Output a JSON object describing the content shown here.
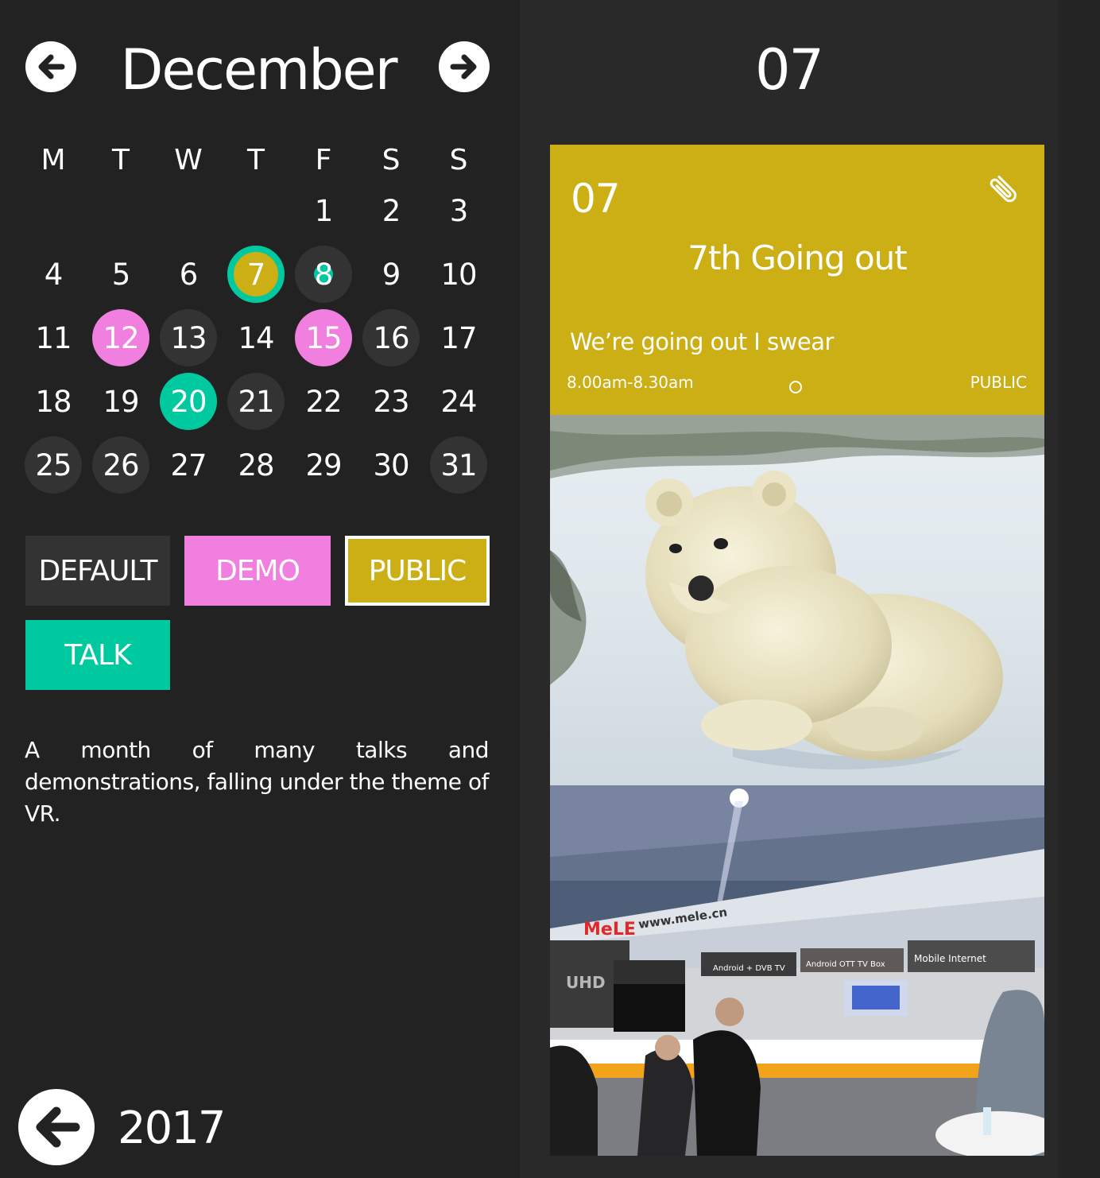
{
  "calendar": {
    "month": "December",
    "weekdays": [
      "M",
      "T",
      "W",
      "T",
      "F",
      "S",
      "S"
    ],
    "days": [
      "1",
      "2",
      "3",
      "4",
      "5",
      "6",
      "7",
      "8",
      "9",
      "10",
      "11",
      "12",
      "13",
      "14",
      "15",
      "16",
      "17",
      "18",
      "19",
      "20",
      "21",
      "22",
      "23",
      "24",
      "25",
      "26",
      "27",
      "28",
      "29",
      "30",
      "31"
    ]
  },
  "categories": {
    "default": "DEFAULT",
    "demo": "DEMO",
    "public": "PUBLIC",
    "talk": "TALK"
  },
  "description": "A month of many talks and demonstrations, falling under the theme of VR.",
  "year": "2017",
  "detail": {
    "day_title": "07",
    "event": {
      "date": "07",
      "title": "7th Going out",
      "description": "We’re going out I swear",
      "time": "8.00am-8.30am",
      "category": "PUBLIC"
    },
    "photo2_signs": {
      "brand": "MeLE",
      "url": "www.mele.cn",
      "uhd": "UHD",
      "sign1": "Android OTT TV Box",
      "sign2": "Mobile Internet",
      "sign3": "Android + DVB TV"
    }
  },
  "colors": {
    "background": "#222222",
    "panel": "#292929",
    "busy": "#333333",
    "demo": "#f07fdf",
    "public": "#ccae15",
    "talk": "#00c9a0"
  },
  "icons": {
    "prev_month": "arrow-left-circle",
    "next_month": "arrow-right-circle",
    "back_year": "arrow-left-circle",
    "attachment": "paperclip"
  }
}
